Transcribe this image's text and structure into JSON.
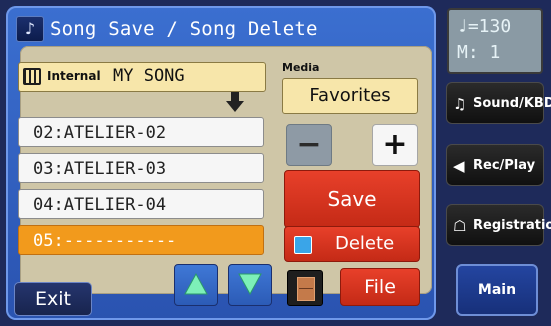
{
  "header": {
    "title": "Song Save / Song Delete",
    "icon": "song-icon"
  },
  "source": {
    "label": "Internal",
    "song_name": "MY SONG",
    "icon": "internal-memory-icon"
  },
  "songs": [
    {
      "label": "02:ATELIER-02",
      "selected": false
    },
    {
      "label": "03:ATELIER-03",
      "selected": false
    },
    {
      "label": "04:ATELIER-04",
      "selected": false
    },
    {
      "label": "05:-----------",
      "selected": true
    }
  ],
  "media": {
    "label": "Media",
    "value": "Favorites"
  },
  "buttons": {
    "minus": "−",
    "plus": "+",
    "save": "Save",
    "delete": "Delete",
    "file": "File",
    "exit": "Exit"
  },
  "tempo": {
    "line1": "♩=130",
    "line2": "M:   1"
  },
  "rail": {
    "sound": "Sound/KBD",
    "rec": "Rec/Play",
    "registration": "Registration",
    "main": "Main"
  },
  "colors": {
    "accent_red": "#d8341f",
    "selected_orange": "#f29a1c",
    "panel_blue": "#2f5fc2",
    "field_yellow": "#f7e6aa"
  }
}
